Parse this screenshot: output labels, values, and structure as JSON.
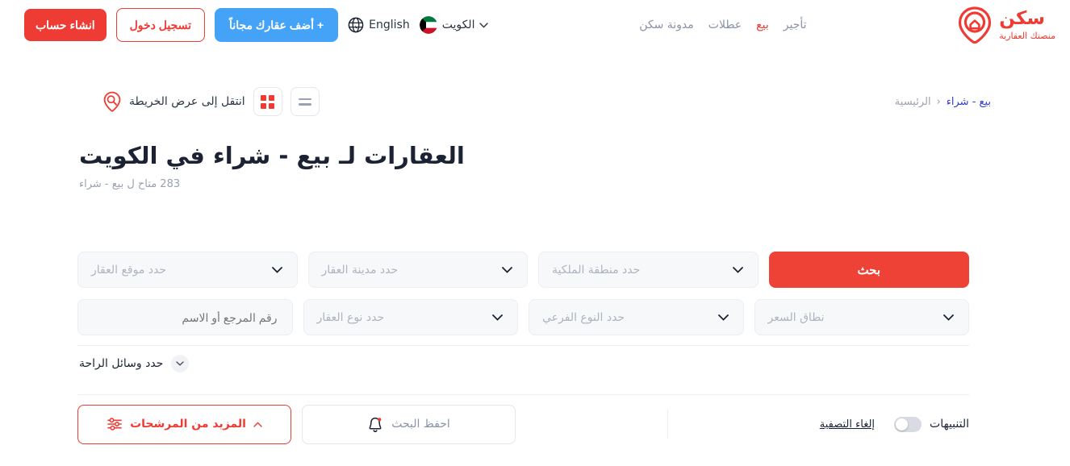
{
  "brand": {
    "name": "سكن",
    "tagline": "منصتك العقارية",
    "logo_icon": "map-pin-house-icon",
    "color": "#ee3b33"
  },
  "header": {
    "nav": [
      {
        "label": "تأجير",
        "active": false
      },
      {
        "label": "بيع",
        "active": true
      },
      {
        "label": "عطلات",
        "active": false
      },
      {
        "label": "مدونة سكن",
        "active": false
      }
    ],
    "language": {
      "label": "English",
      "icon": "globe-icon"
    },
    "country": {
      "label": "الكويت",
      "icon": "kuwait-flag-icon",
      "chevron": "chevron-down-icon"
    },
    "buttons": {
      "add_property": "+ أضف عقارك مجاناً",
      "login": "تسجيل دخول",
      "register": "انشاء حساب"
    },
    "colors": {
      "add_property_bg": "#44a3f7",
      "register_bg": "#ee3b33",
      "login_border": "#ee3b33"
    }
  },
  "toolbar": {
    "breadcrumb": {
      "home": "الرئيسية",
      "separator": "‹",
      "current": "بيع - شراء"
    },
    "map_link": {
      "label": "انتقل إلى عرض الخريطة",
      "icon": "map-search-pin-icon"
    },
    "view_grid": {
      "icon": "grid-view-icon"
    },
    "view_list": {
      "icon": "list-view-icon"
    }
  },
  "page": {
    "title": "العقارات لـ بيع - شراء في الكويت",
    "subtitle": "283 متاح ل بيع - شراء"
  },
  "filters": {
    "row1": [
      {
        "placeholder": "حدد موقع العقار",
        "type": "select",
        "name": "property-location"
      },
      {
        "placeholder": "حدد مدينة العقار",
        "type": "select",
        "name": "property-city"
      },
      {
        "placeholder": "حدد منطقة الملكية",
        "type": "select",
        "name": "property-area"
      }
    ],
    "search_button": "بحث",
    "row2": [
      {
        "placeholder": "رقم المرجع أو الاسم",
        "type": "text",
        "name": "reference-or-name"
      },
      {
        "placeholder": "حدد نوع العقار",
        "type": "select",
        "name": "property-type"
      },
      {
        "placeholder": "حدد النوع الفرعي",
        "type": "select",
        "name": "property-subtype"
      },
      {
        "placeholder": "نطاق السعر",
        "type": "select",
        "name": "price-range"
      }
    ],
    "amenities": {
      "label": "حدد وسائل الراحة",
      "chevron": "chevron-down-icon"
    }
  },
  "bottom": {
    "alerts": {
      "label": "التنبيهات",
      "state": "off"
    },
    "clear_filters": "إلغاء التصفية",
    "save_search": {
      "label": "احفظ البحث",
      "icon": "bell-icon"
    },
    "more_filters": {
      "label": "المزيد من المرشحات",
      "icon": "filter-sliders-icon",
      "chevron": "chevron-up-icon"
    }
  }
}
